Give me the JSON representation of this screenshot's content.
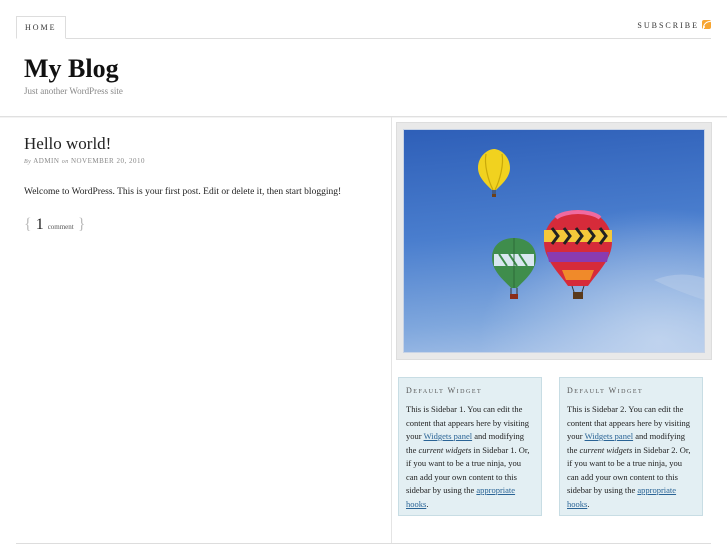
{
  "nav": {
    "home_label": "HOME",
    "subscribe_label": "SUBSCRIBE"
  },
  "site": {
    "title": "My Blog",
    "description": "Just another WordPress site"
  },
  "post": {
    "title": "Hello world!",
    "meta_by": "By",
    "author": "ADMIN",
    "meta_on": "on",
    "date": "NOVEMBER 20, 2010",
    "body": "Welcome to WordPress. This is your first post. Edit or delete it, then start blogging!",
    "comment_count": "1",
    "comment_label": "comment"
  },
  "widgets": [
    {
      "title": "Default Widget",
      "t1": "This is Sidebar 1. You can edit the content that appears here by visiting your ",
      "link1": "Widgets panel",
      "t2": " and modifying the ",
      "em": "current widgets",
      "t3": " in Sidebar 1. Or, if you want to be a true ninja, you can add your own content to this sidebar by using the ",
      "link2": "appropriate hooks",
      "t4": "."
    },
    {
      "title": "Default Widget",
      "t1": "This is Sidebar 2. You can edit the content that appears here by visiting your ",
      "link1": "Widgets panel",
      "t2": " and modifying the ",
      "em": "current widgets",
      "t3": " in Sidebar 2. Or, if you want to be a true ninja, you can add your own content to this sidebar by using the ",
      "link2": "appropriate hooks",
      "t4": "."
    }
  ],
  "colors": {
    "link": "#2a6496",
    "widget_bg": "#e3eff3",
    "sky": "#3b6cc0"
  },
  "icons": {
    "rss": "rss-icon"
  }
}
